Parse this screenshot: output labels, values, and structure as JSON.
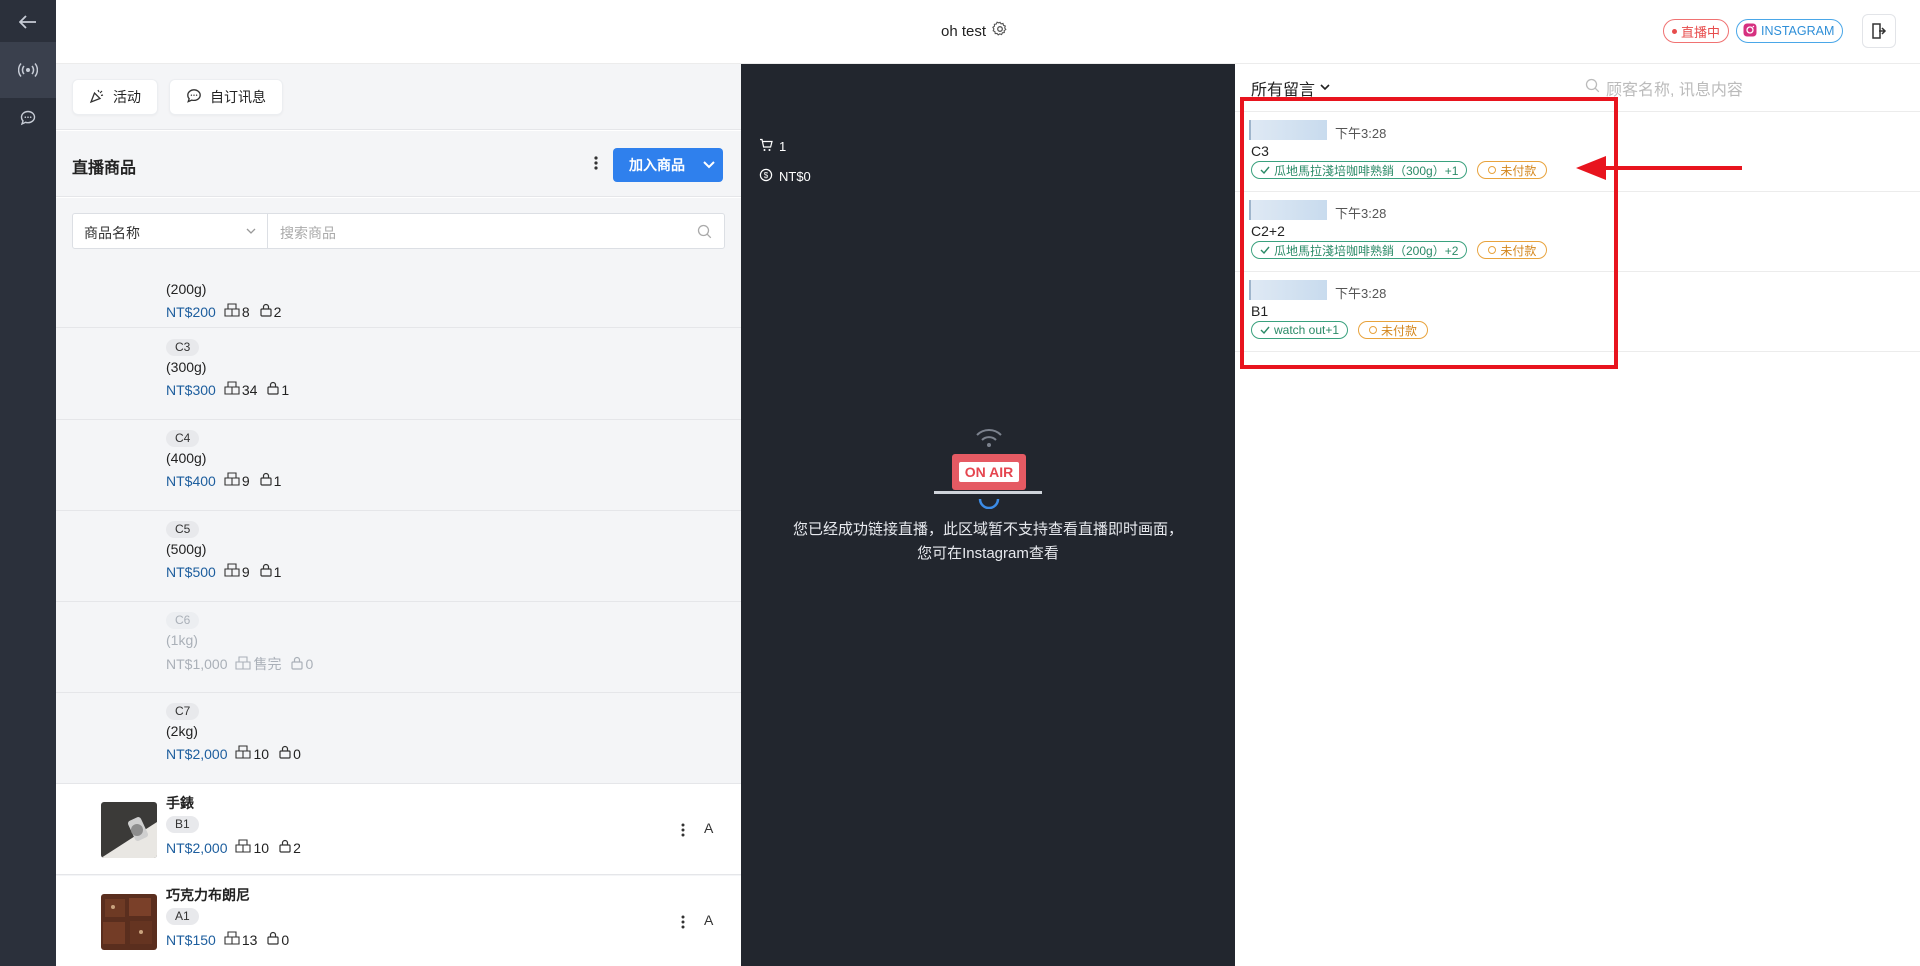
{
  "header": {
    "title": "oh test",
    "live_badge": "直播中",
    "platform_badge": "INSTAGRAM"
  },
  "toolbar": {
    "activity_label": "活动",
    "custom_message_label": "自订讯息"
  },
  "products_section": {
    "title": "直播商品",
    "add_button_label": "加入商品",
    "filter_select_value": "商品名称",
    "search_placeholder": "搜索商品"
  },
  "products": [
    {
      "code": "",
      "variant": "(200g)",
      "price": "NT$200",
      "stock": "8",
      "locked": "2",
      "disabled": false
    },
    {
      "code": "C3",
      "variant": "(300g)",
      "price": "NT$300",
      "stock": "34",
      "locked": "1",
      "disabled": false
    },
    {
      "code": "C4",
      "variant": "(400g)",
      "price": "NT$400",
      "stock": "9",
      "locked": "1",
      "disabled": false
    },
    {
      "code": "C5",
      "variant": "(500g)",
      "price": "NT$500",
      "stock": "9",
      "locked": "1",
      "disabled": false
    },
    {
      "code": "C6",
      "variant": "(1kg)",
      "price": "NT$1,000",
      "stock": "售完",
      "locked": "0",
      "disabled": true
    },
    {
      "code": "C7",
      "variant": "(2kg)",
      "price": "NT$2,000",
      "stock": "10",
      "locked": "0",
      "disabled": false
    }
  ],
  "main_products": [
    {
      "name": "手錶",
      "code": "B1",
      "price": "NT$2,000",
      "stock": "10",
      "locked": "2",
      "action": "A"
    },
    {
      "name": "巧克力布朗尼",
      "code": "A1",
      "price": "NT$150",
      "stock": "13",
      "locked": "0",
      "action": "A"
    }
  ],
  "video": {
    "cart_count": "1",
    "amount": "NT$0",
    "on_air_label": "ON AIR",
    "message_line1": "您已经成功链接直播，此区域暂不支持查看直播即时画面，",
    "message_line2": "您可在Instagram查看"
  },
  "comments_panel": {
    "filter_label": "所有留言",
    "search_placeholder": "顾客名称, 讯息内容"
  },
  "comments": [
    {
      "time": "下午3:28",
      "message": "C3",
      "order_tag": "瓜地馬拉淺培咖啡熟銷（300g）+1",
      "status": "未付款"
    },
    {
      "time": "下午3:28",
      "message": "C2+2",
      "order_tag": "瓜地馬拉淺培咖啡熟銷（200g）+2",
      "status": "未付款"
    },
    {
      "time": "下午3:28",
      "message": "B1",
      "order_tag": "watch out+1",
      "status": "未付款"
    }
  ],
  "colors": {
    "primary": "#2f80ed",
    "live": "#e74c4c",
    "instagram": "#2f8fd8",
    "sidebar": "#2b303b",
    "video_bg": "#22262e",
    "paid_green": "#2b8a67",
    "unpaid_orange": "#d4861c",
    "annotation_red": "#e8141e"
  }
}
